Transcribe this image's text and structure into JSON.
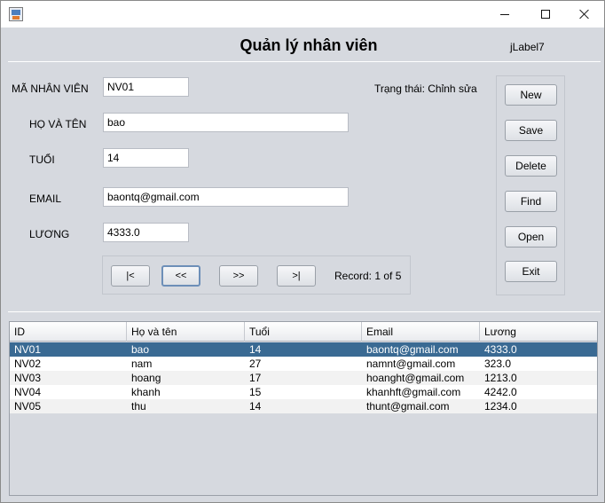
{
  "header": {
    "title": "Quản lý nhân viên",
    "extra_label": "jLabel7"
  },
  "status": "Trạng thái: Chỉnh sửa",
  "form": {
    "id_label": "MÃ NHÂN VIÊN",
    "id_value": "NV01",
    "name_label": "HỌ VÀ TÊN",
    "name_value": "bao",
    "age_label": "TUỔI",
    "age_value": "14",
    "email_label": "EMAIL",
    "email_value": "baontq@gmail.com",
    "salary_label": "LƯƠNG",
    "salary_value": "4333.0"
  },
  "navigation": {
    "first": "|<",
    "prev": "<<",
    "next": ">>",
    "last": ">|",
    "record": "Record: 1 of 5"
  },
  "actions": {
    "new": "New",
    "save": "Save",
    "delete": "Delete",
    "find": "Find",
    "open": "Open",
    "exit": "Exit"
  },
  "table": {
    "columns": [
      "ID",
      "Họ và tên",
      "Tuổi",
      "Email",
      "Lương"
    ],
    "rows": [
      [
        "NV01",
        "bao",
        "14",
        "baontq@gmail.com",
        "4333.0"
      ],
      [
        "NV02",
        "nam",
        "27",
        "namnt@gmail.com",
        "323.0"
      ],
      [
        "NV03",
        "hoang",
        "17",
        "hoanght@gmail.com",
        "1213.0"
      ],
      [
        "NV04",
        "khanh",
        "15",
        "khanhft@gmail.com",
        "4242.0"
      ],
      [
        "NV05",
        "thu",
        "14",
        "thunt@gmail.com",
        "1234.0"
      ]
    ],
    "selected_row": 0
  },
  "colors": {
    "selection": "#3a6a93",
    "panel": "#d6d9df"
  }
}
